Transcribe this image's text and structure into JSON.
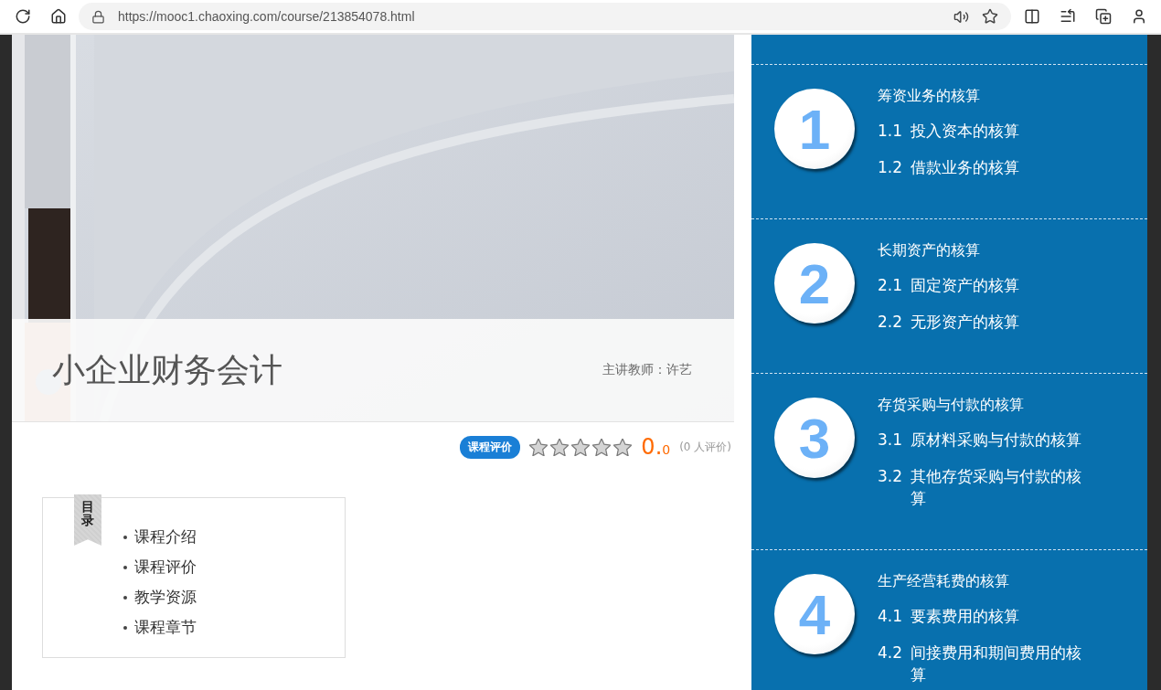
{
  "browser": {
    "url": "https://mooc1.chaoxing.com/course/213854078.html"
  },
  "course": {
    "title": "小企业财务会计",
    "teacher": "主讲教师：许艺",
    "rating_label": "课程评价",
    "stars": 0,
    "score": "0.0",
    "review_count": "(0 人评价)"
  },
  "toc": {
    "label": "目录",
    "items": [
      "课程介绍",
      "课程评价",
      "教学资源",
      "课程章节"
    ]
  },
  "chapters": [
    {
      "number": "1",
      "title": "筹资业务的核算",
      "sections": [
        {
          "number": "1.1",
          "title": "投入资本的核算"
        },
        {
          "number": "1.2",
          "title": "借款业务的核算"
        }
      ]
    },
    {
      "number": "2",
      "title": "长期资产的核算",
      "sections": [
        {
          "number": "2.1",
          "title": "固定资产的核算"
        },
        {
          "number": "2.2",
          "title": "无形资产的核算"
        }
      ]
    },
    {
      "number": "3",
      "title": "存货采购与付款的核算",
      "sections": [
        {
          "number": "3.1",
          "title": "原材料采购与付款的核算"
        },
        {
          "number": "3.2",
          "title": "其他存货采购与付款的核算"
        }
      ]
    },
    {
      "number": "4",
      "title": "生产经营耗费的核算",
      "sections": [
        {
          "number": "4.1",
          "title": "要素费用的核算"
        },
        {
          "number": "4.2",
          "title": "间接费用和期间费用的核算"
        }
      ]
    }
  ]
}
